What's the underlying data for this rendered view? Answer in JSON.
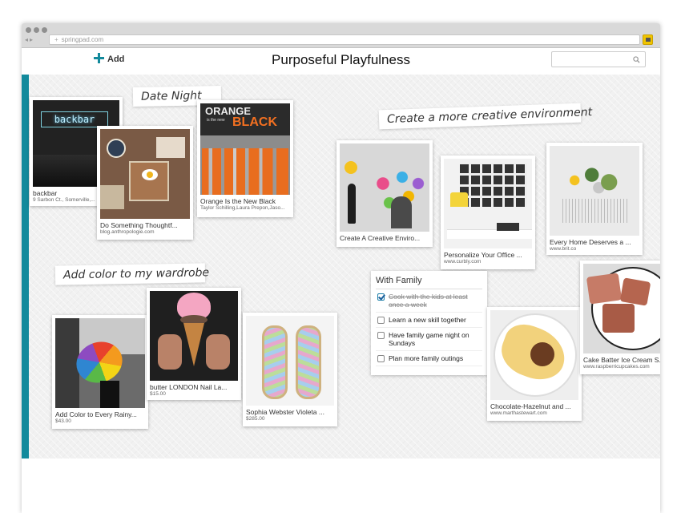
{
  "browser": {
    "url": "springpad.com"
  },
  "header": {
    "add_label": "Add",
    "title": "Purposeful Playfulness",
    "search_placeholder": ""
  },
  "notes": {
    "date_night": "Date Night",
    "creative": "Create a more creative environment",
    "wardrobe": "Add color to my wardrobe"
  },
  "cards": {
    "backbar": {
      "title": "backbar",
      "sub": "9 Sarbon Ct., Somerville,...",
      "sign": "backbar"
    },
    "thoughtful": {
      "title": "Do Something Thoughtf...",
      "sub": "blog.anthropologie.com"
    },
    "oitnb": {
      "title": "Orange Is the New Black",
      "sub": "Taylor Schilling,Laura Prepon,Jaso...",
      "poster_top": "ORANGE",
      "poster_small": "is the new",
      "poster_big": "BLACK"
    },
    "creative_env": {
      "title": "Create A Creative Enviro...",
      "sub": ""
    },
    "office": {
      "title": "Personalize Your Office ...",
      "sub": "www.curbly.com"
    },
    "home": {
      "title": "Every Home Deserves a ...",
      "sub": "www.brit.co"
    },
    "rainy": {
      "title": "Add Color to Every Rainy...",
      "sub": "$43.00"
    },
    "nail": {
      "title": "butter LONDON Nail La...",
      "sub": "$15.00"
    },
    "sandals": {
      "title": "Sophia Webster Violeta ...",
      "sub": "$285.00"
    },
    "crepe": {
      "title": "Chocolate-Hazelnut and ...",
      "sub": "www.marthastewart.com"
    },
    "cake": {
      "title": "Cake Batter Ice Cream S...",
      "sub": "www.raspberricupcakes.com"
    }
  },
  "checklist": {
    "title": "With Family",
    "items": [
      {
        "text": "Cook with the kids at least once a week",
        "checked": true
      },
      {
        "text": "Learn a new skill together",
        "checked": false
      },
      {
        "text": "Have family game night on Sundays",
        "checked": false
      },
      {
        "text": "Plan more family outings",
        "checked": false
      }
    ]
  },
  "colors": {
    "accent": "#138a9c",
    "board": "#f1f1f1"
  },
  "icons": [
    "plus-icon",
    "search-icon",
    "checkbox-icon",
    "extension-icon"
  ]
}
